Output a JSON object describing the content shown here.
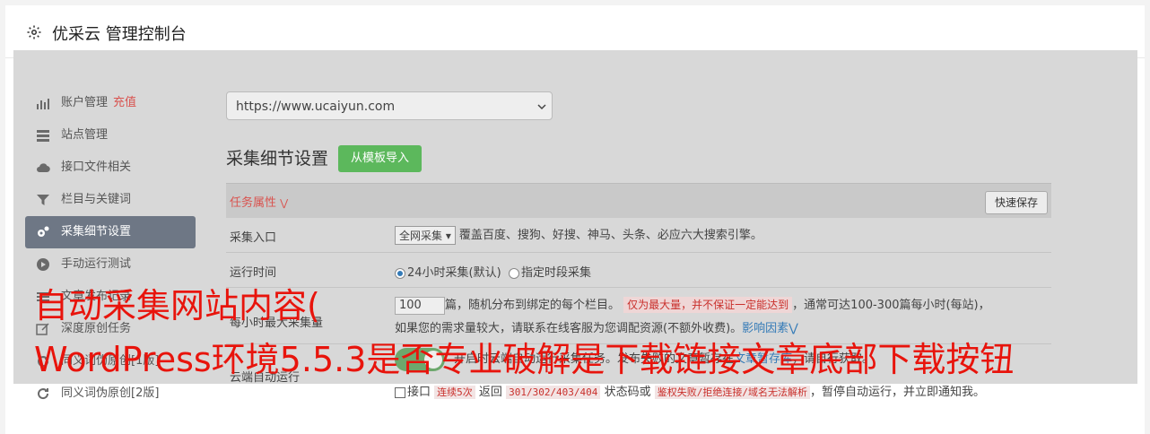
{
  "header": {
    "title": "优采云 管理控制台",
    "icon": "gear-icon"
  },
  "sidebar": {
    "items": [
      {
        "label": "账户管理",
        "extra": "充值",
        "icon": "bar-chart-icon",
        "active": false
      },
      {
        "label": "站点管理",
        "icon": "server-icon",
        "active": false
      },
      {
        "label": "接口文件相关",
        "icon": "cloud-upload-icon",
        "active": false
      },
      {
        "label": "栏目与关键词",
        "icon": "filter-icon",
        "active": false
      },
      {
        "label": "采集细节设置",
        "icon": "gears-icon",
        "active": true
      },
      {
        "label": "手动运行测试",
        "icon": "play-icon",
        "active": false
      },
      {
        "label": "文章发布记录",
        "icon": "list-icon",
        "active": false
      },
      {
        "label": "深度原创任务",
        "icon": "edit-icon",
        "active": false
      },
      {
        "label": "同义词伪原创[1版]",
        "icon": "refresh-icon",
        "active": false
      },
      {
        "label": "同义词伪原创[2版]",
        "icon": "refresh-icon",
        "active": false
      }
    ]
  },
  "site_select": {
    "value": "https://www.ucaiyun.com"
  },
  "section": {
    "title": "采集细节设置",
    "import_button": "从模板导入"
  },
  "task": {
    "label": "任务属性",
    "save_button": "快速保存"
  },
  "rows": {
    "entry": {
      "label": "采集入口",
      "select": "全网采集",
      "desc": "覆盖百度、搜狗、好搜、神马、头条、必应六大搜索引擎。"
    },
    "time": {
      "label": "运行时间",
      "option1": "24小时采集(默认)",
      "option2": "指定时段采集"
    },
    "hourly": {
      "label": "每小时最大采集量",
      "value": "100",
      "text1": "篇，随机分布到绑定的每个栏目。",
      "warn": "仅为最大量，并不保证一定能达到",
      "text2": "，通常可达100-300篇每小时(每站)，",
      "text3": "如果您的需求量较大，请联系在线客服为您调配资源(不额外收费)。",
      "link": "影响因素"
    },
    "cloud": {
      "label": "云端自动运行",
      "desc1": "开启时云端自动运行采集任务。发布失败的文章暂存在",
      "desc_link": "文章暂存库",
      "desc2": "，请自行获取。",
      "check_prefix": "接口",
      "code1": "连续5次",
      "mid1": "返回",
      "code2": "301/302/403/404",
      "mid2": "状态码或",
      "code3": "鉴权失败/拒绝连接/域名无法解析",
      "tail": "，暂停自动运行，并立即通知我。"
    }
  },
  "overlay": {
    "line1": "自动采集网站内容(",
    "line2": "WordPress环境5.5.3是否专业破解是下载链接文章底部下载按钮",
    "color": "#e8140c"
  }
}
